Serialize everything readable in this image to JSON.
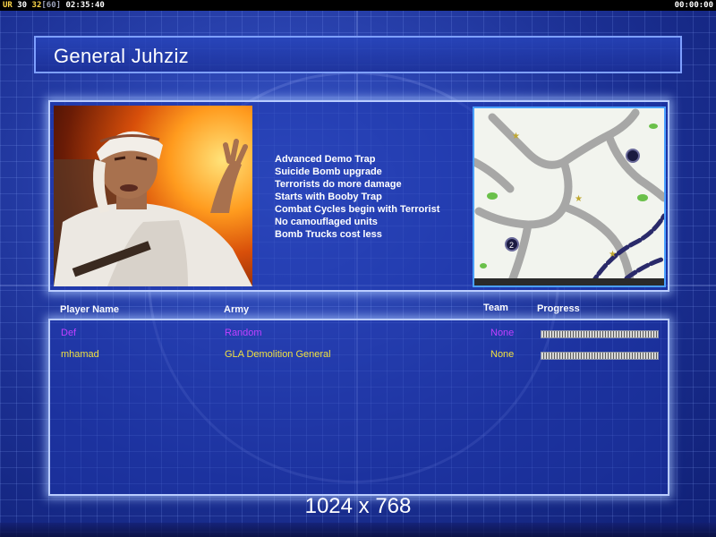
{
  "hud": {
    "label": "UR",
    "num1": "30",
    "num2": "32",
    "bracket": "[60]",
    "clock": "02:35:40",
    "timer": "00:00:00"
  },
  "header": {
    "title": "General Juhziz"
  },
  "general": {
    "traits": [
      "Advanced Demo Trap",
      "Suicide Bomb upgrade",
      "Terrorists do more damage",
      "Starts with Booby Trap",
      "Combat Cycles begin with Terrorist",
      "No camouflaged units",
      "Bomb Trucks cost less"
    ],
    "minimap": {
      "start_positions": [
        "1",
        "2"
      ]
    }
  },
  "players": {
    "columns": {
      "name": "Player Name",
      "army": "Army",
      "team": "Team",
      "progress": "Progress"
    },
    "rows": [
      {
        "name": "Def",
        "army": "Random",
        "team": "None",
        "progress": 1.0,
        "color": "#c040ff"
      },
      {
        "name": "mhamad",
        "army": "GLA Demolition General",
        "team": "None",
        "progress": 1.0,
        "color": "#f0e040"
      }
    ]
  },
  "footer": {
    "resolution": "1024 x 768"
  }
}
